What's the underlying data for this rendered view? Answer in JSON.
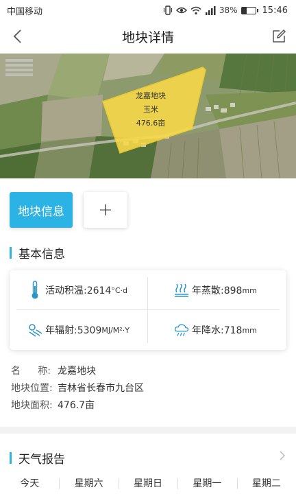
{
  "status_bar": {
    "carrier": "中国移动",
    "battery_percent": "38%",
    "battery_level": 0.38,
    "time": "15:46",
    "signal_label": "4G"
  },
  "header": {
    "title": "地块详情"
  },
  "map": {
    "field_name": "龙嘉地块",
    "crop": "玉米",
    "area": "476.6亩",
    "polygon_color": "#f7d84a"
  },
  "tabs": {
    "active_label": "地块信息",
    "add_label": "+"
  },
  "basic_info": {
    "title": "基本信息",
    "metrics": {
      "accumulated_temp_label": "活动积温:2614",
      "accumulated_temp_unit": "°C·d",
      "evaporation_label": "年蒸散:898",
      "evaporation_unit": "mm",
      "radiation_label": "年辐射:5309",
      "radiation_unit": "MJ/M²·Y",
      "precipitation_label": "年降水:718",
      "precipitation_unit": "mm"
    },
    "fields": {
      "name_key_1": "名",
      "name_key_2": "称:",
      "name_value": "龙嘉地块",
      "location_key": "地块位置:",
      "location_value": "吉林省长春市九台区",
      "area_key": "地块面积:",
      "area_value": "476.7亩"
    }
  },
  "weather": {
    "title": "天气报告",
    "days": [
      "今天",
      "星期六",
      "星期日",
      "星期一",
      "星期二"
    ]
  },
  "colors": {
    "accent": "#2cb3e6"
  },
  "icons": [
    "signal-icon",
    "eye-icon",
    "wifi-icon",
    "battery-icon",
    "back-chevron-icon",
    "edit-icon",
    "thermometer-icon",
    "evaporation-icon",
    "radiation-icon",
    "rain-cloud-icon",
    "chevron-right-icon"
  ]
}
